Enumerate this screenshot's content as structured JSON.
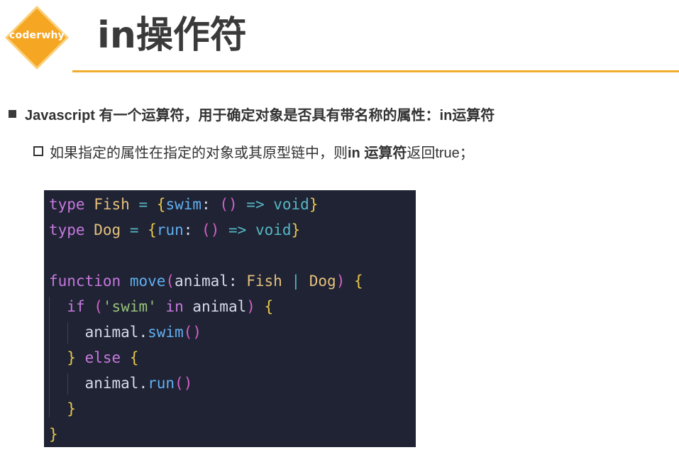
{
  "logo": {
    "text": "coderwhy"
  },
  "title": "in操作符",
  "bullets": {
    "level1": "Javascript 有一个运算符，用于确定对象是否具有带名称的属性：in运算符",
    "level2_prefix": "如果指定的属性在指定的对象或其原型链中，则",
    "level2_bold": "in 运算符",
    "level2_suffix": "返回true；"
  },
  "code": {
    "language": "typescript",
    "lines": [
      "type Fish = {swim: () => void}",
      "type Dog = {run: () => void}",
      "",
      "function move(animal: Fish | Dog) {",
      "  if ('swim' in animal) {",
      "    animal.swim()",
      "  } else {",
      "    animal.run()",
      "  }",
      "}"
    ]
  },
  "colors": {
    "accent": "#f0ad2e",
    "logo_fill": "#f5a623",
    "code_bg": "#1f2334",
    "keyword": "#c678dd",
    "type": "#e5c07b",
    "function": "#61afef",
    "string": "#98c379"
  }
}
